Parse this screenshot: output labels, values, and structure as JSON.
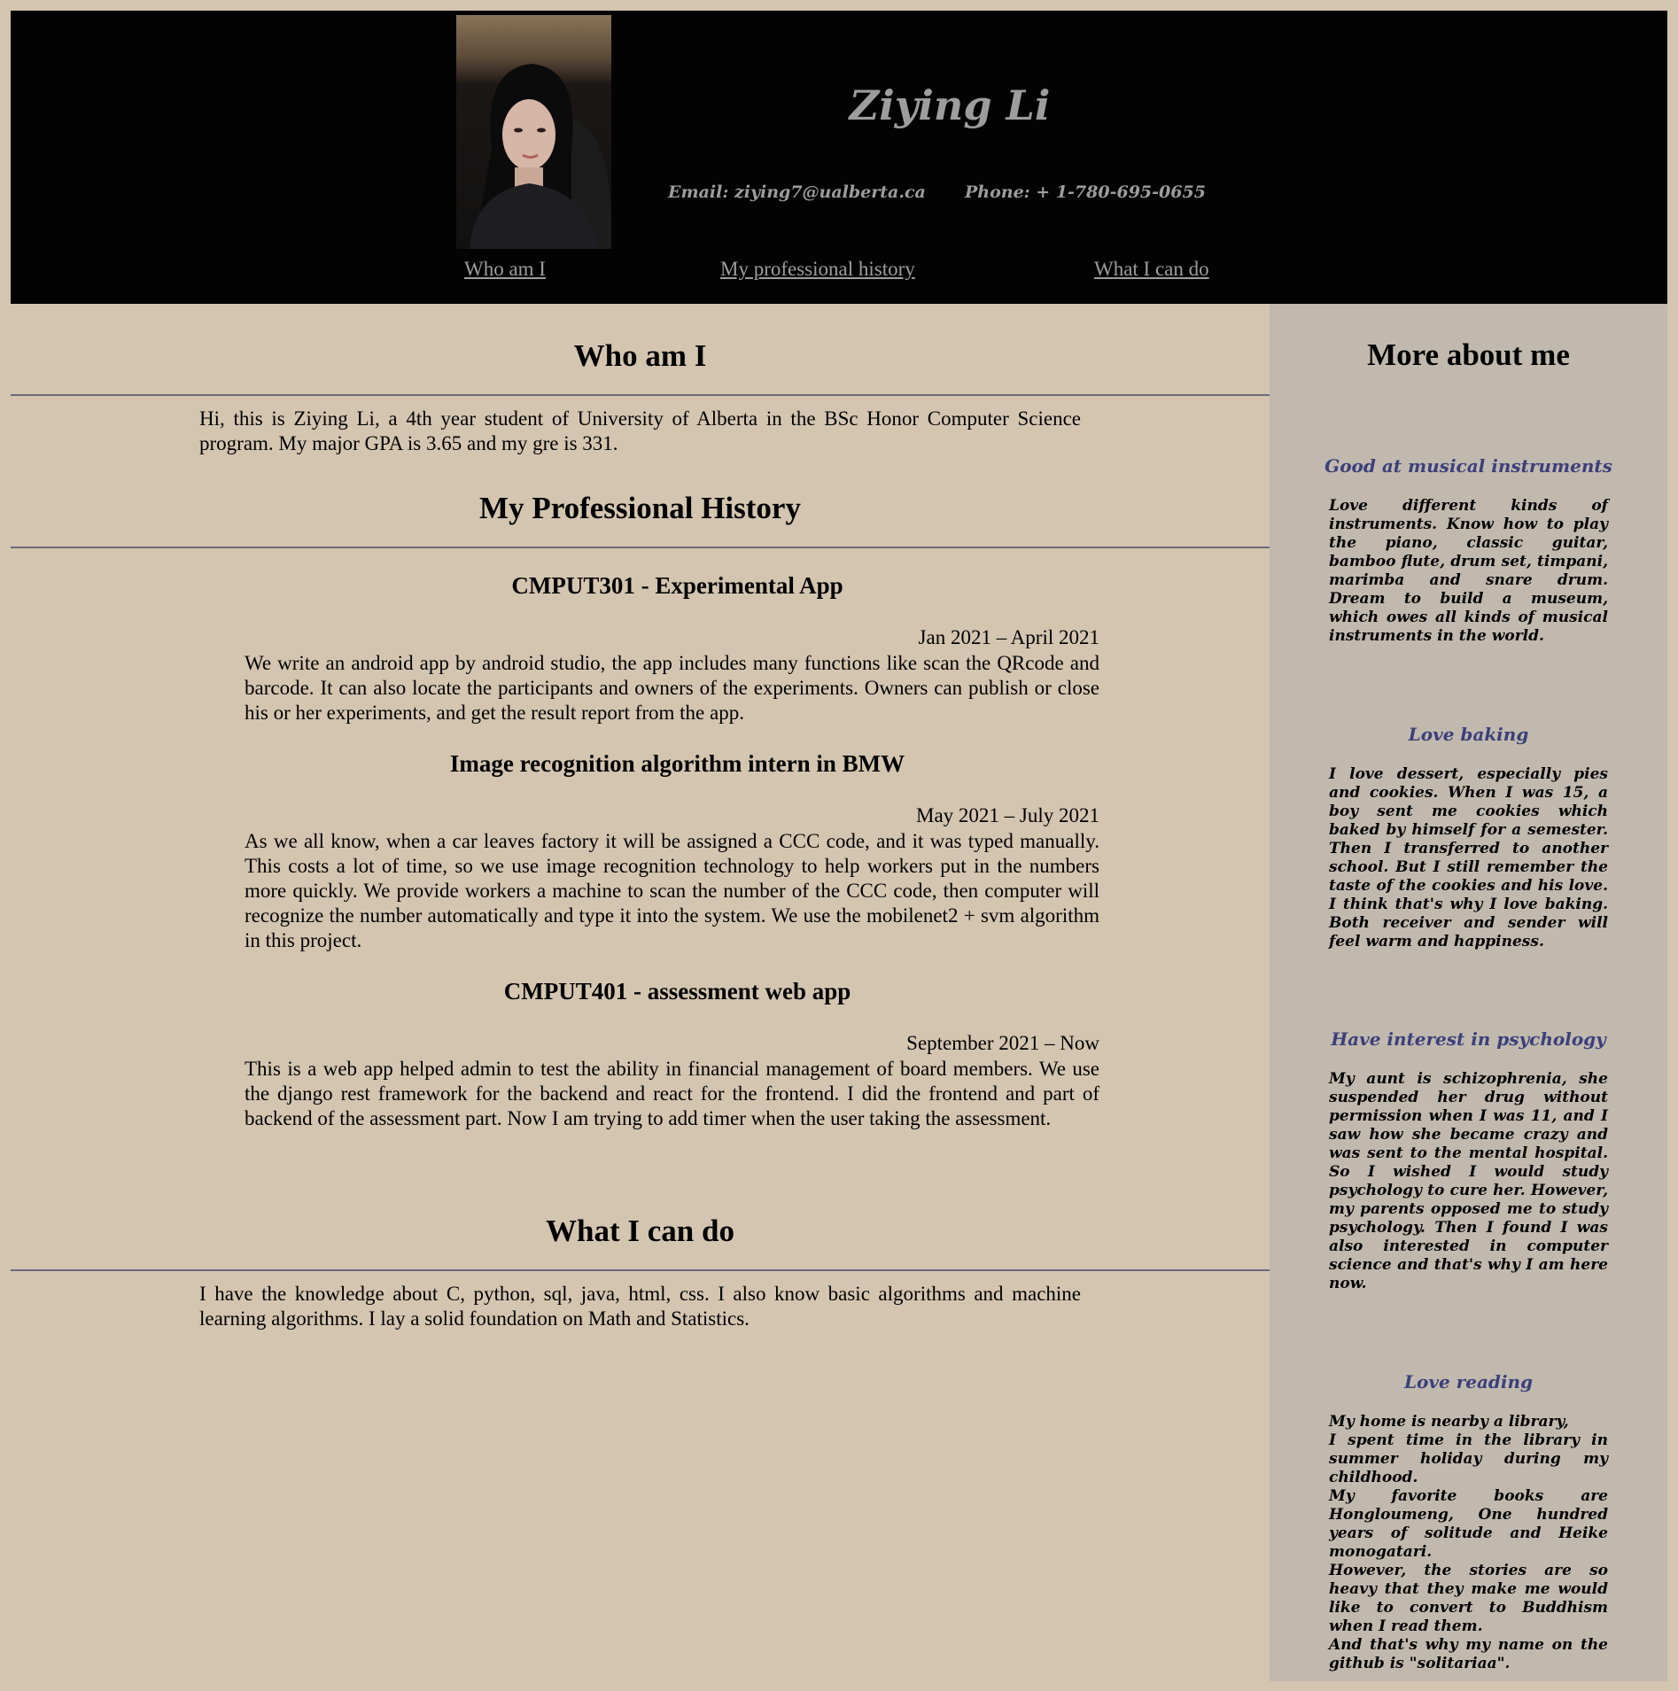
{
  "header": {
    "name": "Ziying Li",
    "email": "Email: ziying7@ualberta.ca",
    "phone": "Phone: + 1-780-695-0655",
    "nav": [
      "Who am I",
      "My professional history",
      "What I can do"
    ]
  },
  "who": {
    "title": "Who am I",
    "text": "Hi, this is Ziying Li, a 4th year student of University of Alberta in the BSc Honor Computer Science program. My major GPA is 3.65 and my gre is 331."
  },
  "history": {
    "title": "My Professional History",
    "jobs": [
      {
        "title": "CMPUT301 - Experimental App",
        "date": "Jan 2021 – April 2021",
        "desc": "We write an android app by android studio, the app includes many functions like scan the QRcode and barcode. It can also locate the participants and owners of the experiments. Owners can publish or close his or her experiments, and get the result report from the app."
      },
      {
        "title": "Image recognition algorithm intern in BMW",
        "date": "May 2021 – July 2021",
        "desc": "As we all know, when a car leaves factory it will be assigned a CCC code, and it was typed manually. This costs a lot of time, so we use image recognition technology to help workers put in the numbers more quickly. We provide workers a machine to scan the number of the CCC code, then computer will recognize the number automatically and type it into the system. We use the mobilenet2 + svm algorithm in this project."
      },
      {
        "title": "CMPUT401 - assessment web app",
        "date": "September 2021 – Now",
        "desc": "This is a web app helped admin to test the ability in financial management of board members. We use the django rest framework for the backend and react for the frontend. I did the frontend and part of backend of the assessment part. Now I am trying to add timer when the user taking the assessment."
      }
    ]
  },
  "cando": {
    "title": "What I can do",
    "text": "I have the knowledge about C, python, sql, java, html, css. I also know basic algorithms and machine learning algorithms. I lay a solid foundation on Math and Statistics."
  },
  "aside": {
    "title": "More about me",
    "interests": [
      {
        "title": "Good at musical instruments",
        "body": "Love different kinds of instruments. Know how to play the piano, classic guitar, bamboo flute, drum set, timpani, marimba and snare drum. Dream to build a museum, which owes all kinds of musical instruments in the world."
      },
      {
        "title": "Love baking",
        "body": "I love dessert, especially pies and cookies. When I was 15, a boy sent me cookies which baked by himself for a semester. Then I transferred to another school. But I still remember the taste of the cookies and his love. I think that's why I love baking. Both receiver and sender will feel warm and happiness."
      },
      {
        "title": "Have interest in psychology",
        "body": "My aunt is schizophrenia, she suspended her drug without permission when I was 11, and I saw how she became crazy and was sent to the mental hospital. So I wished I would study psychology to cure her. However, my parents opposed me to study psychology. Then I found I was also interested in computer science and that's why I am here now."
      },
      {
        "title": "Love reading",
        "lines": [
          "My home is nearby a library,",
          "I spent time in the library in summer holiday during my childhood.",
          "My favorite books are Hongloumeng, One hundred years of solitude and Heike monogatari.",
          "However, the stories are so heavy that they make me would like to convert to Buddhism when I read them.",
          "And that's why my name on the github is \"solitariaa\"."
        ]
      }
    ]
  }
}
